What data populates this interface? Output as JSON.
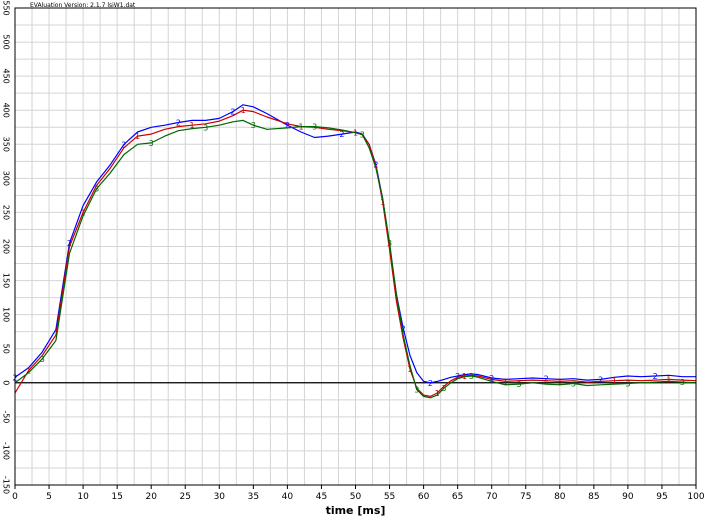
{
  "chart_data": {
    "type": "line",
    "title": "EVAluation Version: 2.1.7 lsiW1.dat",
    "xlabel": "time [ms]",
    "ylabel": "",
    "xlim": [
      0,
      100
    ],
    "ylim": [
      -150,
      550
    ],
    "x_ticks": [
      0,
      5,
      10,
      15,
      20,
      25,
      30,
      35,
      40,
      45,
      50,
      55,
      60,
      65,
      70,
      75,
      80,
      85,
      90,
      95,
      100
    ],
    "y_ticks": [
      -150,
      -100,
      -50,
      0,
      50,
      100,
      150,
      200,
      250,
      300,
      350,
      400,
      450,
      500,
      550
    ],
    "grid": true,
    "zero_line": true,
    "legend": "none",
    "series": [
      {
        "color": "#0000ff",
        "marker": "2",
        "x": [
          0,
          2,
          4,
          6,
          8,
          10,
          12,
          14,
          16,
          18,
          20,
          22,
          24,
          26,
          28,
          30,
          32,
          33.5,
          35,
          37,
          40,
          42,
          44,
          46,
          48,
          50,
          51,
          52,
          53,
          54,
          55,
          56,
          57,
          58,
          59,
          60,
          61,
          62,
          63,
          64,
          65,
          66,
          67,
          68,
          70,
          72,
          74,
          76,
          78,
          80,
          82,
          84,
          86,
          88,
          90,
          92,
          94,
          96,
          98,
          100
        ],
        "y": [
          8,
          22,
          45,
          78,
          205,
          260,
          295,
          320,
          350,
          368,
          375,
          378,
          382,
          385,
          385,
          388,
          398,
          408,
          405,
          395,
          378,
          368,
          360,
          362,
          365,
          368,
          365,
          350,
          320,
          270,
          200,
          130,
          80,
          40,
          15,
          2,
          0,
          2,
          5,
          8,
          10,
          12,
          13,
          12,
          7,
          5,
          6,
          7,
          6,
          5,
          6,
          4,
          5,
          8,
          10,
          9,
          10,
          11,
          9,
          9
        ]
      },
      {
        "color": "#cc0000",
        "marker": "1",
        "x": [
          0,
          2,
          4,
          6,
          8,
          10,
          12,
          14,
          16,
          18,
          20,
          22,
          24,
          26,
          28,
          30,
          32,
          33.5,
          35,
          37,
          40,
          42,
          44,
          46,
          48,
          50,
          51,
          52,
          53,
          54,
          55,
          56,
          57,
          58,
          59,
          60,
          61,
          62,
          63,
          64,
          65,
          66,
          67,
          68,
          70,
          72,
          74,
          76,
          78,
          80,
          82,
          84,
          86,
          88,
          90,
          92,
          94,
          96,
          98,
          100
        ],
        "y": [
          -15,
          18,
          40,
          70,
          200,
          250,
          290,
          315,
          345,
          362,
          365,
          372,
          376,
          378,
          380,
          384,
          392,
          400,
          398,
          390,
          380,
          376,
          375,
          372,
          370,
          367,
          364,
          350,
          318,
          265,
          195,
          120,
          65,
          20,
          -8,
          -18,
          -20,
          -15,
          -5,
          3,
          8,
          10,
          11,
          10,
          5,
          2,
          3,
          4,
          3,
          2,
          3,
          1,
          2,
          3,
          4,
          3,
          4,
          5,
          4,
          3
        ]
      },
      {
        "color": "#006600",
        "marker": "3",
        "x": [
          0,
          2,
          4,
          6,
          8,
          10,
          12,
          14,
          16,
          18,
          20,
          22,
          24,
          26,
          28,
          30,
          32,
          33.5,
          35,
          37,
          40,
          42,
          44,
          46,
          48,
          50,
          51,
          52,
          53,
          54,
          55,
          56,
          57,
          58,
          59,
          60,
          61,
          62,
          63,
          64,
          65,
          66,
          67,
          68,
          70,
          72,
          74,
          76,
          78,
          80,
          82,
          84,
          86,
          88,
          90,
          92,
          94,
          96,
          98,
          100
        ],
        "y": [
          0,
          15,
          35,
          62,
          190,
          245,
          285,
          308,
          335,
          350,
          352,
          362,
          370,
          373,
          375,
          378,
          383,
          385,
          378,
          372,
          374,
          376,
          376,
          374,
          371,
          367,
          364,
          345,
          315,
          270,
          205,
          130,
          70,
          25,
          -10,
          -20,
          -22,
          -18,
          -8,
          0,
          6,
          9,
          10,
          8,
          2,
          -3,
          -2,
          0,
          -2,
          -3,
          -1,
          -4,
          -3,
          -2,
          -1,
          0,
          1,
          2,
          1,
          0
        ]
      }
    ]
  }
}
